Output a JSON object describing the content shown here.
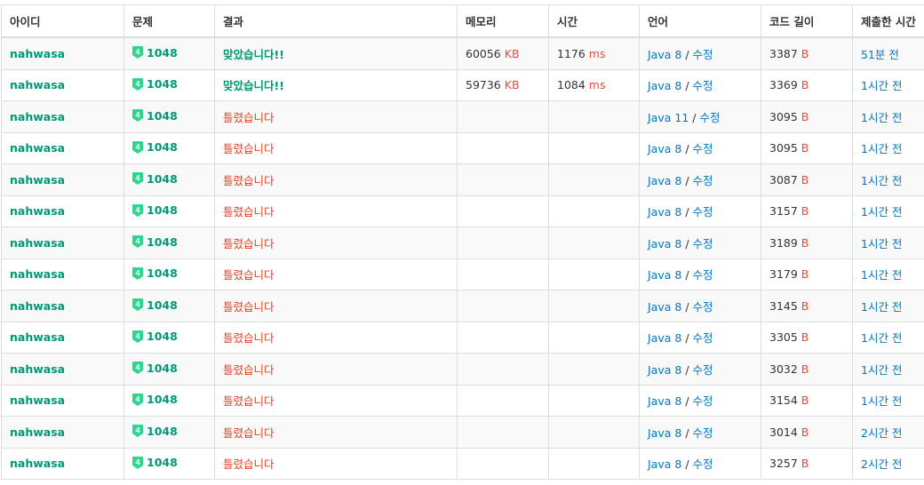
{
  "colors": {
    "accent_green": "#009874",
    "wrong_red": "#dd4124",
    "unit_red": "#e74c3c",
    "link_blue": "#0076c0",
    "badge_green": "#2dd68e"
  },
  "headers": {
    "id": "아이디",
    "problem": "문제",
    "result": "결과",
    "memory": "메모리",
    "time": "시간",
    "language": "언어",
    "code_length": "코드 길이",
    "submitted": "제출한 시간"
  },
  "badge": {
    "icon": "tier-badge-icon",
    "text": "4"
  },
  "units": {
    "memory": "KB",
    "time": "ms",
    "code": "B"
  },
  "edit_label": "수정",
  "rows": [
    {
      "user": "nahwasa",
      "problem": "1048",
      "result": "맞았습니다!!",
      "accepted": true,
      "memory": "60056",
      "time": "1176",
      "language": "Java 8",
      "code_length": "3387",
      "submitted": "51분 전"
    },
    {
      "user": "nahwasa",
      "problem": "1048",
      "result": "맞았습니다!!",
      "accepted": true,
      "memory": "59736",
      "time": "1084",
      "language": "Java 8",
      "code_length": "3369",
      "submitted": "1시간 전"
    },
    {
      "user": "nahwasa",
      "problem": "1048",
      "result": "틀렸습니다",
      "accepted": false,
      "memory": "",
      "time": "",
      "language": "Java 11",
      "code_length": "3095",
      "submitted": "1시간 전"
    },
    {
      "user": "nahwasa",
      "problem": "1048",
      "result": "틀렸습니다",
      "accepted": false,
      "memory": "",
      "time": "",
      "language": "Java 8",
      "code_length": "3095",
      "submitted": "1시간 전"
    },
    {
      "user": "nahwasa",
      "problem": "1048",
      "result": "틀렸습니다",
      "accepted": false,
      "memory": "",
      "time": "",
      "language": "Java 8",
      "code_length": "3087",
      "submitted": "1시간 전"
    },
    {
      "user": "nahwasa",
      "problem": "1048",
      "result": "틀렸습니다",
      "accepted": false,
      "memory": "",
      "time": "",
      "language": "Java 8",
      "code_length": "3157",
      "submitted": "1시간 전"
    },
    {
      "user": "nahwasa",
      "problem": "1048",
      "result": "틀렸습니다",
      "accepted": false,
      "memory": "",
      "time": "",
      "language": "Java 8",
      "code_length": "3189",
      "submitted": "1시간 전"
    },
    {
      "user": "nahwasa",
      "problem": "1048",
      "result": "틀렸습니다",
      "accepted": false,
      "memory": "",
      "time": "",
      "language": "Java 8",
      "code_length": "3179",
      "submitted": "1시간 전"
    },
    {
      "user": "nahwasa",
      "problem": "1048",
      "result": "틀렸습니다",
      "accepted": false,
      "memory": "",
      "time": "",
      "language": "Java 8",
      "code_length": "3145",
      "submitted": "1시간 전"
    },
    {
      "user": "nahwasa",
      "problem": "1048",
      "result": "틀렸습니다",
      "accepted": false,
      "memory": "",
      "time": "",
      "language": "Java 8",
      "code_length": "3305",
      "submitted": "1시간 전"
    },
    {
      "user": "nahwasa",
      "problem": "1048",
      "result": "틀렸습니다",
      "accepted": false,
      "memory": "",
      "time": "",
      "language": "Java 8",
      "code_length": "3032",
      "submitted": "1시간 전"
    },
    {
      "user": "nahwasa",
      "problem": "1048",
      "result": "틀렸습니다",
      "accepted": false,
      "memory": "",
      "time": "",
      "language": "Java 8",
      "code_length": "3154",
      "submitted": "1시간 전"
    },
    {
      "user": "nahwasa",
      "problem": "1048",
      "result": "틀렸습니다",
      "accepted": false,
      "memory": "",
      "time": "",
      "language": "Java 8",
      "code_length": "3014",
      "submitted": "2시간 전"
    },
    {
      "user": "nahwasa",
      "problem": "1048",
      "result": "틀렸습니다",
      "accepted": false,
      "memory": "",
      "time": "",
      "language": "Java 8",
      "code_length": "3257",
      "submitted": "2시간 전"
    }
  ]
}
